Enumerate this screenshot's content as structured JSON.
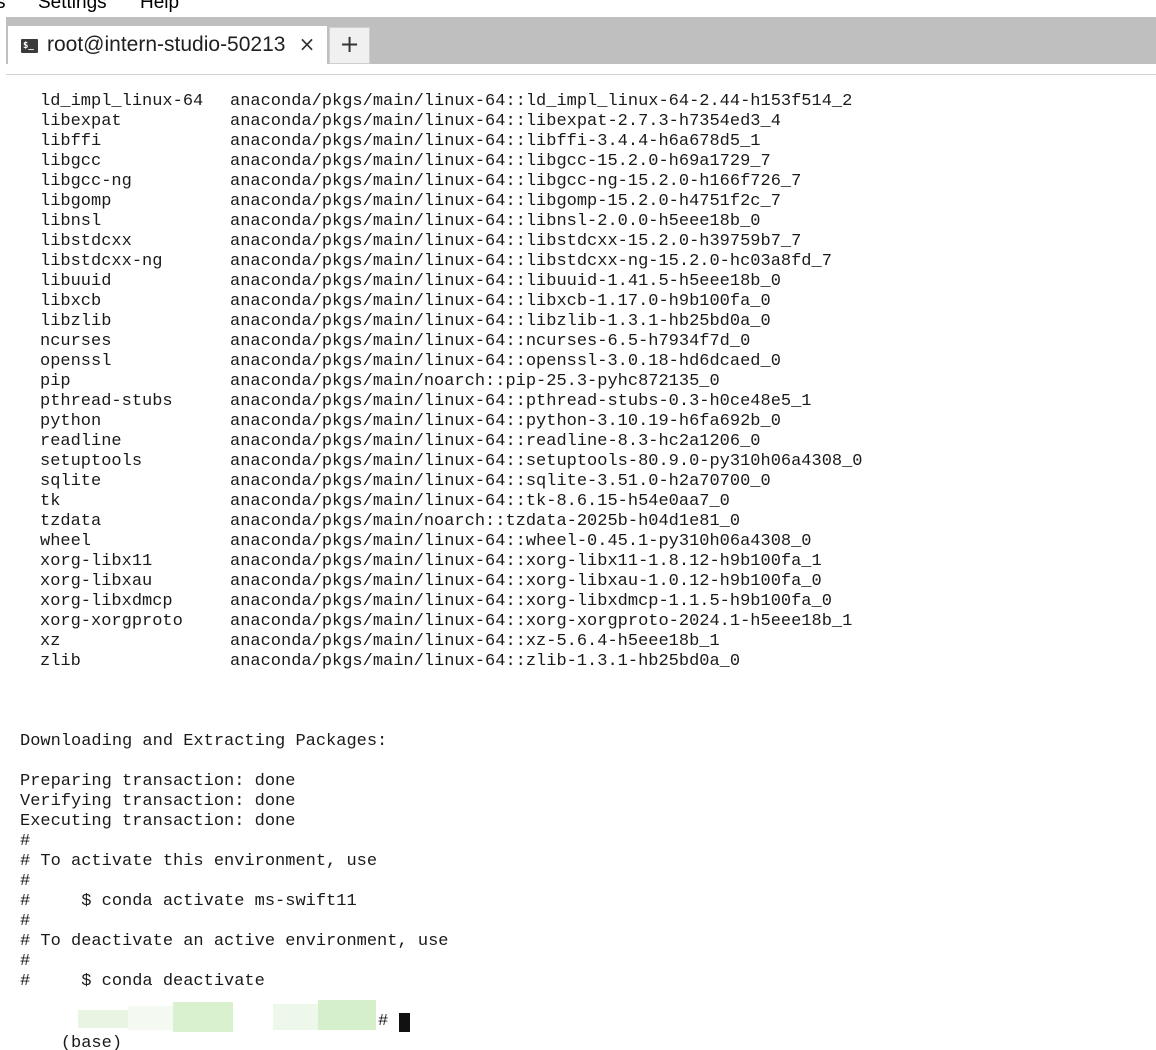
{
  "menubar": {
    "items": [
      "s",
      "Settings",
      "Help"
    ]
  },
  "tabs": [
    {
      "title": "root@intern-studio-50213",
      "icon": "terminal-icon",
      "close_glyph": "×"
    }
  ],
  "new_tab_glyph": "+",
  "tab_icon_glyph": "$_",
  "packages": [
    {
      "name": "ld_impl_linux-64",
      "source": "anaconda/pkgs/main/linux-64::ld_impl_linux-64-2.44-h153f514_2"
    },
    {
      "name": "libexpat",
      "source": "anaconda/pkgs/main/linux-64::libexpat-2.7.3-h7354ed3_4"
    },
    {
      "name": "libffi",
      "source": "anaconda/pkgs/main/linux-64::libffi-3.4.4-h6a678d5_1"
    },
    {
      "name": "libgcc",
      "source": "anaconda/pkgs/main/linux-64::libgcc-15.2.0-h69a1729_7"
    },
    {
      "name": "libgcc-ng",
      "source": "anaconda/pkgs/main/linux-64::libgcc-ng-15.2.0-h166f726_7"
    },
    {
      "name": "libgomp",
      "source": "anaconda/pkgs/main/linux-64::libgomp-15.2.0-h4751f2c_7"
    },
    {
      "name": "libnsl",
      "source": "anaconda/pkgs/main/linux-64::libnsl-2.0.0-h5eee18b_0"
    },
    {
      "name": "libstdcxx",
      "source": "anaconda/pkgs/main/linux-64::libstdcxx-15.2.0-h39759b7_7"
    },
    {
      "name": "libstdcxx-ng",
      "source": "anaconda/pkgs/main/linux-64::libstdcxx-ng-15.2.0-hc03a8fd_7"
    },
    {
      "name": "libuuid",
      "source": "anaconda/pkgs/main/linux-64::libuuid-1.41.5-h5eee18b_0"
    },
    {
      "name": "libxcb",
      "source": "anaconda/pkgs/main/linux-64::libxcb-1.17.0-h9b100fa_0"
    },
    {
      "name": "libzlib",
      "source": "anaconda/pkgs/main/linux-64::libzlib-1.3.1-hb25bd0a_0"
    },
    {
      "name": "ncurses",
      "source": "anaconda/pkgs/main/linux-64::ncurses-6.5-h7934f7d_0"
    },
    {
      "name": "openssl",
      "source": "anaconda/pkgs/main/linux-64::openssl-3.0.18-hd6dcaed_0"
    },
    {
      "name": "pip",
      "source": "anaconda/pkgs/main/noarch::pip-25.3-pyhc872135_0"
    },
    {
      "name": "pthread-stubs",
      "source": "anaconda/pkgs/main/linux-64::pthread-stubs-0.3-h0ce48e5_1"
    },
    {
      "name": "python",
      "source": "anaconda/pkgs/main/linux-64::python-3.10.19-h6fa692b_0"
    },
    {
      "name": "readline",
      "source": "anaconda/pkgs/main/linux-64::readline-8.3-hc2a1206_0"
    },
    {
      "name": "setuptools",
      "source": "anaconda/pkgs/main/linux-64::setuptools-80.9.0-py310h06a4308_0"
    },
    {
      "name": "sqlite",
      "source": "anaconda/pkgs/main/linux-64::sqlite-3.51.0-h2a70700_0"
    },
    {
      "name": "tk",
      "source": "anaconda/pkgs/main/linux-64::tk-8.6.15-h54e0aa7_0"
    },
    {
      "name": "tzdata",
      "source": "anaconda/pkgs/main/noarch::tzdata-2025b-h04d1e81_0"
    },
    {
      "name": "wheel",
      "source": "anaconda/pkgs/main/linux-64::wheel-0.45.1-py310h06a4308_0"
    },
    {
      "name": "xorg-libx11",
      "source": "anaconda/pkgs/main/linux-64::xorg-libx11-1.8.12-h9b100fa_1"
    },
    {
      "name": "xorg-libxau",
      "source": "anaconda/pkgs/main/linux-64::xorg-libxau-1.0.12-h9b100fa_0"
    },
    {
      "name": "xorg-libxdmcp",
      "source": "anaconda/pkgs/main/linux-64::xorg-libxdmcp-1.1.5-h9b100fa_0"
    },
    {
      "name": "xorg-xorgproto",
      "source": "anaconda/pkgs/main/linux-64::xorg-xorgproto-2024.1-h5eee18b_1"
    },
    {
      "name": "xz",
      "source": "anaconda/pkgs/main/linux-64::xz-5.6.4-h5eee18b_1"
    },
    {
      "name": "zlib",
      "source": "anaconda/pkgs/main/linux-64::zlib-1.3.1-hb25bd0a_0"
    }
  ],
  "output_lines": [
    "Downloading and Extracting Packages:",
    "",
    "Preparing transaction: done",
    "Verifying transaction: done",
    "Executing transaction: done",
    "#",
    "# To activate this environment, use",
    "#",
    "#     $ conda activate ms-swift11",
    "#",
    "# To deactivate an active environment, use",
    "#",
    "#     $ conda deactivate"
  ],
  "prompt": {
    "prefix": "(base)",
    "suffix": "#"
  },
  "colors": {
    "tab_strip": "#bfbfbf",
    "text": "#1a1a1a",
    "redaction_green": "#d8f0cf"
  }
}
